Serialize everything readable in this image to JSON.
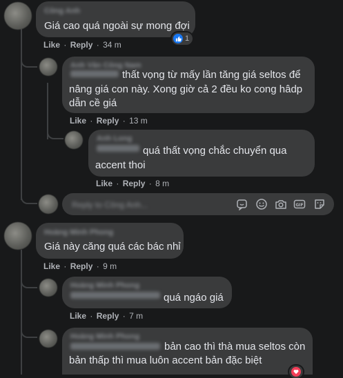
{
  "labels": {
    "like": "Like",
    "reply": "Reply",
    "dot": "·"
  },
  "comments": [
    {
      "author": "Công Anh",
      "text_lines": [
        "Giá cao quá ngoài sự mong đợi"
      ],
      "time": "34 m",
      "reaction_count": "1",
      "replies": [
        {
          "author": "Anh Văn Công Nam",
          "text_first": "thất vọng từ mấy lần tăng giá seltos để",
          "text_lines": [
            "nâng giá con này. Xong giờ cả 2 đều ko cong hâdp",
            "dẫn cề giá"
          ],
          "time": "13 m"
        },
        {
          "author": "Anh Long",
          "text_first": "quá thất vọng chắc chuyển qua",
          "text_lines": [
            "accent thoi"
          ],
          "time": "8 m"
        }
      ],
      "reply_placeholder": "Reply to Công Anh..."
    },
    {
      "author": "Hoàng Minh Phong",
      "text_lines": [
        "Giá này căng quá các bác nhỉ"
      ],
      "time": "9 m",
      "replies": [
        {
          "author": "Hoàng Minh Phong",
          "text_first": "quá ngáo giá",
          "time": "7 m"
        },
        {
          "author": "Hoàng Minh Phong",
          "text_first": "bản cao thì thà mua seltos còn",
          "text_lines": [
            "bản thấp thì mua luôn accent bản đặc biệt"
          ]
        }
      ]
    }
  ],
  "icons": [
    "sticker-smile-icon",
    "emoji-icon",
    "camera-icon",
    "gif-icon",
    "sticker-icon"
  ],
  "colors": {
    "background": "#18191a",
    "bubble": "#3a3b3c",
    "text": "#e4e6eb",
    "secondary": "#b0b3b8",
    "like_blue": "#1877f2",
    "love_red": "#f33e58"
  }
}
